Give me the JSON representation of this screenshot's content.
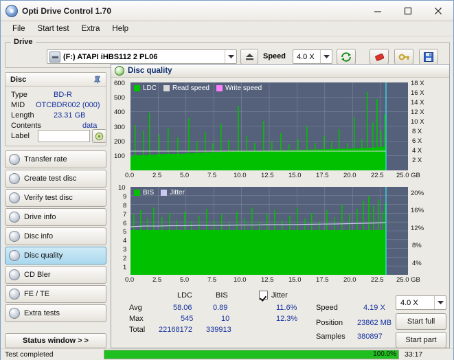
{
  "window": {
    "title": "Opti Drive Control 1.70",
    "icon": "disc-icon",
    "minimize": "minimize",
    "maximize": "maximize",
    "close": "close"
  },
  "menu": [
    {
      "label": "File"
    },
    {
      "label": "Start test"
    },
    {
      "label": "Extra"
    },
    {
      "label": "Help"
    }
  ],
  "drive": {
    "legend": "Drive",
    "selected": "(F:)  ATAPI iHBS112   2 PL06",
    "eject": "eject-icon",
    "speed_label": "Speed",
    "speed_value": "4.0 X",
    "tools": [
      "refresh-icon",
      "eraser-icon",
      "key-icon",
      "save-icon"
    ]
  },
  "disc": {
    "title": "Disc",
    "pin": "pin-icon",
    "rows": [
      {
        "label": "Type",
        "value": "BD-R"
      },
      {
        "label": "MID",
        "value": "OTCBDR002 (000)"
      },
      {
        "label": "Length",
        "value": "23.31 GB"
      },
      {
        "label": "Contents",
        "value": "data"
      },
      {
        "label": "Label",
        "value": ""
      }
    ],
    "label_button": "label-edit-icon"
  },
  "sidebar": {
    "items": [
      {
        "label": "Transfer rate",
        "active": false
      },
      {
        "label": "Create test disc",
        "active": false
      },
      {
        "label": "Verify test disc",
        "active": false
      },
      {
        "label": "Drive info",
        "active": false
      },
      {
        "label": "Disc info",
        "active": false
      },
      {
        "label": "Disc quality",
        "active": true
      },
      {
        "label": "CD Bler",
        "active": false
      },
      {
        "label": "FE / TE",
        "active": false
      },
      {
        "label": "Extra tests",
        "active": false
      }
    ],
    "status_window": "Status window > >"
  },
  "quality": {
    "title": "Disc quality",
    "results": {
      "col_ldc": "LDC",
      "col_bis": "BIS",
      "rows": [
        {
          "label": "Avg",
          "ldc": "58.06",
          "bis": "0.89"
        },
        {
          "label": "Max",
          "ldc": "545",
          "bis": "10"
        },
        {
          "label": "Total",
          "ldc": "22168172",
          "bis": "339913"
        }
      ],
      "jitter_label": "Jitter",
      "jitter_checked": true,
      "jitter_avg": "11.6%",
      "jitter_max": "12.3%",
      "speed_label": "Speed",
      "speed_value": "4.19 X",
      "position_label": "Position",
      "position_value": "23862 MB",
      "samples_label": "Samples",
      "samples_value": "380897",
      "speed_select": "4.0 X",
      "start_full": "Start full",
      "start_part": "Start part"
    }
  },
  "statusbar": {
    "text": "Test completed",
    "progress_percent": "100.0%",
    "progress_value": 100,
    "time": "33:17"
  },
  "colors": {
    "ldc": "#00c000",
    "bis": "#a0a0e8",
    "read_speed": "#d8d8d8",
    "write_speed": "#ff80ff",
    "jitter": "#c8c8f0",
    "plot_bg": "#55617a",
    "accent": "#1fbf1f"
  },
  "chart_data": [
    {
      "type": "area",
      "name": "LDC / speed chart",
      "title": "",
      "xlabel": "GB",
      "ylabel": "",
      "legend": [
        {
          "label": "LDC",
          "color": "#00c000"
        },
        {
          "label": "Read speed",
          "color": "#d8d8d8"
        },
        {
          "label": "Write speed",
          "color": "#ff80ff"
        }
      ],
      "xticks": [
        "0.0",
        "2.5",
        "5.0",
        "7.5",
        "10.0",
        "12.5",
        "15.0",
        "17.5",
        "20.0",
        "22.5",
        "25.0 GB"
      ],
      "yticks_left": [
        "100",
        "200",
        "300",
        "400",
        "500",
        "600"
      ],
      "yticks_right": [
        "2 X",
        "4 X",
        "6 X",
        "8 X",
        "10 X",
        "12 X",
        "14 X",
        "16 X",
        "18 X"
      ],
      "ylim": [
        0,
        640
      ],
      "ylim_right": [
        0,
        19
      ],
      "grid": true,
      "series": [
        {
          "name": "LDC",
          "color": "#00c000",
          "x": [
            0.0,
            0.5,
            1.0,
            1.5,
            2.0,
            2.5,
            3.0,
            3.5,
            4.0,
            4.5,
            5.0,
            5.5,
            6.0,
            6.5,
            7.0,
            7.5,
            8.0,
            8.5,
            9.0,
            9.5,
            10.0,
            10.5,
            11.0,
            11.5,
            12.0,
            12.5,
            13.0,
            13.5,
            14.0,
            14.5,
            15.0,
            15.5,
            16.0,
            16.5,
            17.0,
            17.5,
            18.0,
            18.5,
            19.0,
            19.5,
            20.0,
            20.5,
            21.0,
            21.5,
            22.0,
            22.5,
            23.0
          ],
          "values": [
            95,
            100,
            100,
            102,
            102,
            100,
            102,
            104,
            104,
            106,
            108,
            108,
            110,
            110,
            112,
            112,
            114,
            114,
            116,
            116,
            118,
            118,
            120,
            120,
            122,
            122,
            124,
            124,
            126,
            126,
            128,
            128,
            130,
            132,
            132,
            134,
            134,
            136,
            138,
            138,
            140,
            142,
            144,
            146,
            148,
            150,
            150
          ]
        },
        {
          "name": "Read speed",
          "color": "#d8d8d8",
          "x": [
            0.0,
            23.0
          ],
          "values": [
            4.19,
            4.19
          ]
        }
      ],
      "annotations": [
        "vertical cyan cursor near 22.9 GB"
      ]
    },
    {
      "type": "area",
      "name": "BIS / jitter chart",
      "title": "",
      "xlabel": "GB",
      "ylabel": "",
      "legend": [
        {
          "label": "BIS",
          "color": "#00c000"
        },
        {
          "label": "Jitter",
          "color": "#c8c8f0"
        }
      ],
      "xticks": [
        "0.0",
        "2.5",
        "5.0",
        "7.5",
        "10.0",
        "12.5",
        "15.0",
        "17.5",
        "20.0",
        "22.5",
        "25.0 GB"
      ],
      "yticks_left": [
        "1",
        "2",
        "3",
        "4",
        "5",
        "6",
        "7",
        "8",
        "9",
        "10"
      ],
      "yticks_right": [
        "4%",
        "8%",
        "12%",
        "16%",
        "20%"
      ],
      "ylim": [
        0,
        10
      ],
      "ylim_right": [
        0,
        20
      ],
      "grid": true,
      "series": [
        {
          "name": "BIS",
          "color": "#00c000",
          "x": [
            0.0,
            2.5,
            5.0,
            7.5,
            10.0,
            12.5,
            15.0,
            17.5,
            20.0,
            22.5,
            23.0
          ],
          "values": [
            5.2,
            5.0,
            5.1,
            5.0,
            5.2,
            5.1,
            5.0,
            5.2,
            5.3,
            5.6,
            5.8
          ]
        },
        {
          "name": "Jitter",
          "color": "#c8c8f0",
          "x": [
            0.0,
            2.5,
            5.0,
            7.5,
            10.0,
            12.5,
            15.0,
            17.5,
            20.0,
            22.5,
            23.0
          ],
          "values": [
            5.6,
            5.7,
            5.7,
            5.8,
            5.8,
            5.8,
            5.9,
            5.9,
            6.0,
            6.1,
            6.15
          ]
        }
      ],
      "annotations": [
        "vertical cyan cursor near 22.9 GB"
      ]
    }
  ]
}
